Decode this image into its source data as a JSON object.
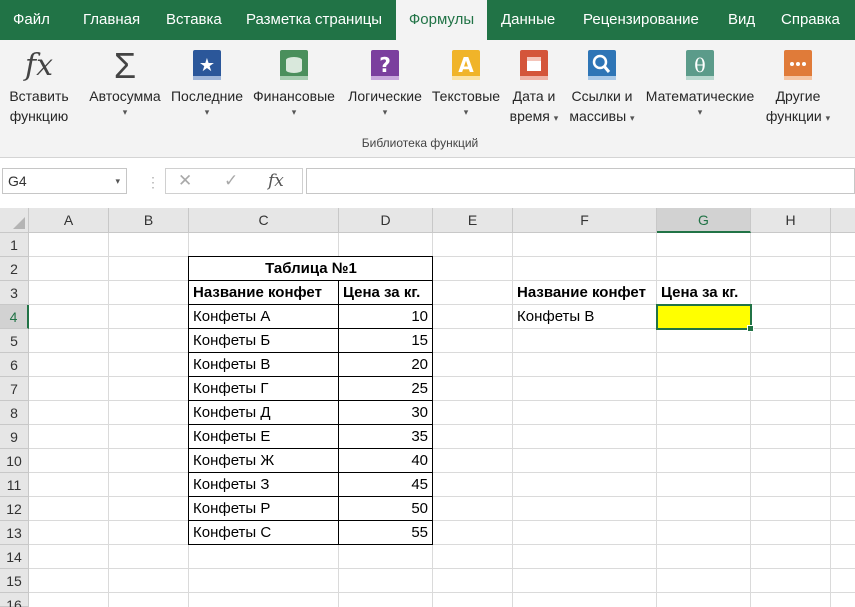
{
  "ribbon_tabs": [
    {
      "label": "Файл"
    },
    {
      "label": "Главная"
    },
    {
      "label": "Вставка"
    },
    {
      "label": "Разметка страницы"
    },
    {
      "label": "Формулы",
      "active": true
    },
    {
      "label": "Данные"
    },
    {
      "label": "Рецензирование"
    },
    {
      "label": "Вид"
    },
    {
      "label": "Справка"
    }
  ],
  "ribbon": {
    "insert_function": {
      "line1": "Вставить",
      "line2": "функцию",
      "icon": "fx-icon"
    },
    "autosum": {
      "label": "Автосумма",
      "icon": "sigma-icon"
    },
    "recent": {
      "label": "Последние",
      "icon": "star-book-icon"
    },
    "financial": {
      "label": "Финансовые",
      "icon": "coins-book-icon"
    },
    "logical": {
      "label": "Логические",
      "icon": "question-book-icon"
    },
    "text": {
      "label": "Текстовые",
      "icon": "letter-a-book-icon"
    },
    "datetime": {
      "line1": "Дата и",
      "line2": "время",
      "icon": "calendar-book-icon"
    },
    "lookup": {
      "line1": "Ссылки и",
      "line2": "массивы",
      "icon": "magnifier-book-icon"
    },
    "math": {
      "label": "Математические",
      "icon": "theta-book-icon"
    },
    "more": {
      "line1": "Другие",
      "line2": "функции",
      "icon": "dots-book-icon"
    },
    "group_label": "Библиотека функций"
  },
  "formula_bar": {
    "name_box": "G4",
    "formula": "",
    "cancel_icon": "✕",
    "enter_icon": "✓",
    "fx_icon": "fx"
  },
  "columns": [
    "A",
    "B",
    "C",
    "D",
    "E",
    "F",
    "G",
    "H"
  ],
  "rows": [
    "1",
    "2",
    "3",
    "4",
    "5",
    "6",
    "7",
    "8",
    "9",
    "10",
    "11",
    "12",
    "13",
    "14",
    "15",
    "16"
  ],
  "selected_cell": "G4",
  "selected_fill": "#ffff00",
  "table": {
    "title": "Таблица №1",
    "headers": [
      "Название конфет",
      "Цена за кг."
    ],
    "rows": [
      {
        "name": "Конфеты А",
        "price": "10"
      },
      {
        "name": "Конфеты Б",
        "price": "15"
      },
      {
        "name": "Конфеты В",
        "price": "20"
      },
      {
        "name": "Конфеты Г",
        "price": "25"
      },
      {
        "name": "Конфеты Д",
        "price": "30"
      },
      {
        "name": "Конфеты Е",
        "price": "35"
      },
      {
        "name": "Конфеты Ж",
        "price": "40"
      },
      {
        "name": "Конфеты З",
        "price": "45"
      },
      {
        "name": "Конфеты Р",
        "price": "50"
      },
      {
        "name": "Конфеты С",
        "price": "55"
      }
    ]
  },
  "lookup_area": {
    "header_name": "Название конфет",
    "header_price": "Цена за кг.",
    "query_name": "Конфеты В",
    "result": ""
  }
}
